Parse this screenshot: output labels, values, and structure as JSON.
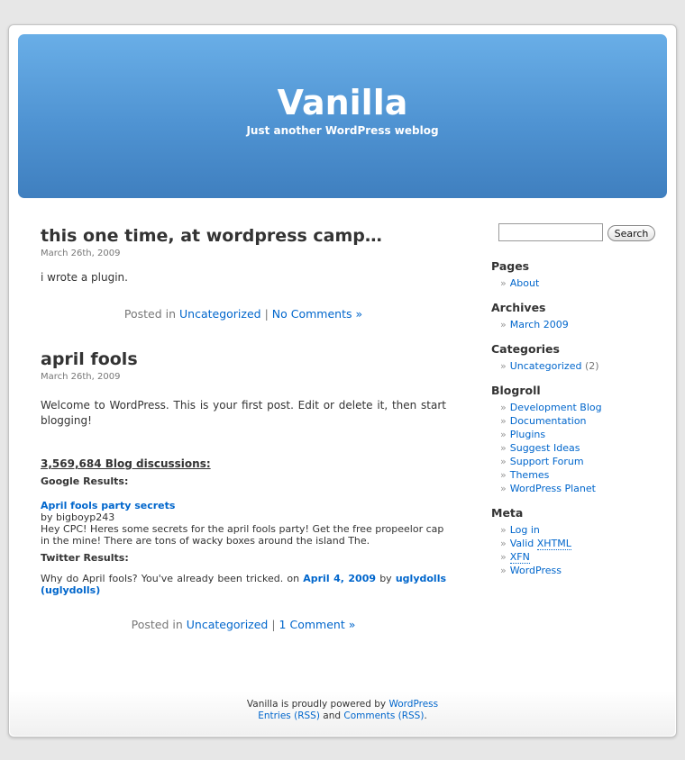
{
  "blog": {
    "title": "Vanilla",
    "description": "Just another WordPress weblog"
  },
  "posts": [
    {
      "title": "this one time, at wordpress camp…",
      "date": "March 26th, 2009",
      "content": "i wrote a plugin.",
      "posted_in_label": "Posted in",
      "category": "Uncategorized",
      "separator": "|",
      "comments": "No Comments »"
    },
    {
      "title": "april fools",
      "date": "March 26th, 2009",
      "content": "Welcome to WordPress. This is your first post. Edit or delete it, then start blogging!",
      "discussions_heading": "3,569,684 Blog discussions:",
      "google_heading": "Google Results:",
      "google_title": "April fools party secrets",
      "google_author": "by bigboyp243",
      "google_snippet": "Hey CPC! Heres some secrets for the april fools party! Get the free propeelor cap in the mine! There are tons of wacky boxes around the island The.",
      "twitter_heading": "Twitter Results:",
      "twitter_text": "Why do April fools? You've already been tricked.",
      "twitter_on": "on",
      "twitter_date": "April 4, 2009",
      "twitter_by": "by",
      "twitter_user": "uglydolls (uglydolls)",
      "posted_in_label": "Posted in",
      "category": "Uncategorized",
      "separator": "|",
      "comments": "1 Comment »"
    }
  ],
  "sidebar": {
    "search_button": "Search",
    "search_value": "",
    "pages": {
      "title": "Pages",
      "items": [
        "About"
      ]
    },
    "archives": {
      "title": "Archives",
      "items": [
        "March 2009"
      ]
    },
    "categories": {
      "title": "Categories",
      "items": [
        {
          "label": "Uncategorized",
          "count": "(2)"
        }
      ]
    },
    "blogroll": {
      "title": "Blogroll",
      "items": [
        "Development Blog",
        "Documentation",
        "Plugins",
        "Suggest Ideas",
        "Support Forum",
        "Themes",
        "WordPress Planet"
      ]
    },
    "meta": {
      "title": "Meta",
      "log_in": "Log in",
      "valid": "Valid",
      "xhtml": "XHTML",
      "xfn": "XFN",
      "wordpress": "WordPress"
    },
    "bullet": "»"
  },
  "footer": {
    "powered_text": "Vanilla is proudly powered by",
    "powered_link": "WordPress",
    "entries_rss": "Entries (RSS)",
    "and": "and",
    "comments_rss": "Comments (RSS)",
    "period": "."
  },
  "colors": {
    "link": "#0066cc",
    "header_top": "#69aee7",
    "header_bottom": "#3f7fbf"
  }
}
